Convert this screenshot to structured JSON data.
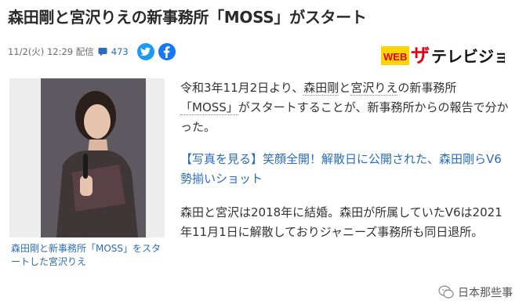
{
  "article": {
    "title": "森田剛と宮沢りえの新事務所「MOSS」がスタート",
    "date": "11/2(火) 12:29 配信",
    "comment_count": "473",
    "logo_text": "WEB ザテレビジョン",
    "photo_caption": "森田剛と新事務所「MOSS」をスタートした宮沢りえ",
    "p1": {
      "t1": "令和3年11月2日より、",
      "t2": "森田剛",
      "t3": "と",
      "t4": "宮沢りえ",
      "t5": "の新事務所",
      "t6": "「MOSS」",
      "t7": "がスタートすることが、新事務所からの報告で分かった。"
    },
    "p2": "【写真を見る】笑顔全開！解散日に公開された、森田剛らV6勢揃いショット",
    "p3": "森田と宮沢は2018年に結婚。森田が所属していたV6は2021年11月1日に解散しておりジャニーズ事務所も同日退所。"
  },
  "watermark": {
    "text": "日本那些事"
  },
  "colors": {
    "link": "#2a6cc0",
    "twitter": "#1d9bf0",
    "facebook": "#1877f2",
    "logo_accent": "#e60012",
    "logo_badge": "#ffd400"
  }
}
